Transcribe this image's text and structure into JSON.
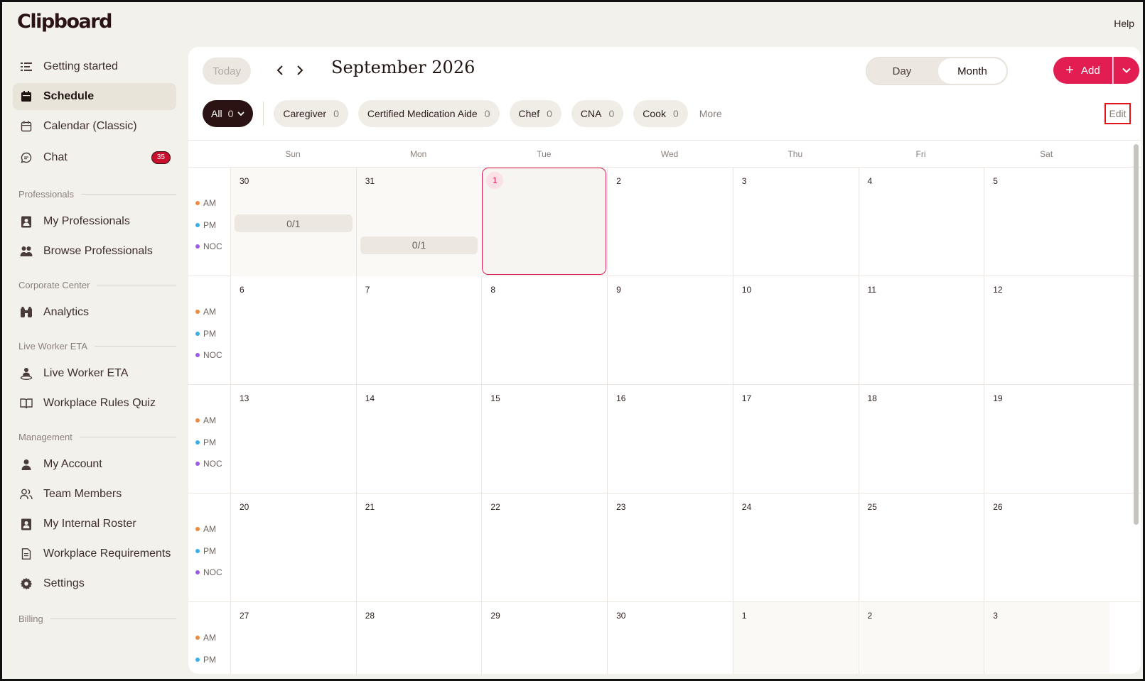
{
  "app": {
    "logo": "Clipboard",
    "help": "Help"
  },
  "sidebar": {
    "top_items": [
      {
        "label": "Getting started",
        "icon": "list-icon"
      },
      {
        "label": "Schedule",
        "icon": "calendar-filled-icon",
        "active": true
      },
      {
        "label": "Calendar (Classic)",
        "icon": "calendar-icon"
      },
      {
        "label": "Chat",
        "icon": "chat-icon",
        "badge": "35"
      }
    ],
    "sections": [
      {
        "title": "Professionals",
        "items": [
          {
            "label": "My Professionals"
          },
          {
            "label": "Browse Professionals"
          }
        ]
      },
      {
        "title": "Corporate Center",
        "items": [
          {
            "label": "Analytics"
          }
        ]
      },
      {
        "title": "Live Worker ETA",
        "items": [
          {
            "label": "Live Worker ETA"
          },
          {
            "label": "Workplace Rules Quiz"
          }
        ]
      },
      {
        "title": "Management",
        "items": [
          {
            "label": "My Account"
          },
          {
            "label": "Team Members"
          },
          {
            "label": "My Internal Roster"
          },
          {
            "label": "Workplace Requirements"
          },
          {
            "label": "Settings"
          }
        ]
      },
      {
        "title": "Billing"
      }
    ]
  },
  "toolbar": {
    "today": "Today",
    "month_title": "September 2026",
    "view_day": "Day",
    "view_month": "Month",
    "add": "Add",
    "add_plus": "+"
  },
  "filters": {
    "all": {
      "label": "All",
      "count": "0"
    },
    "chips": [
      {
        "label": "Caregiver",
        "count": "0"
      },
      {
        "label": "Certified Medication Aide",
        "count": "0"
      },
      {
        "label": "Chef",
        "count": "0"
      },
      {
        "label": "CNA",
        "count": "0"
      },
      {
        "label": "Cook",
        "count": "0"
      }
    ],
    "more": "More",
    "edit": "Edit"
  },
  "calendar": {
    "weekdays": [
      "Sun",
      "Mon",
      "Tue",
      "Wed",
      "Thu",
      "Fri",
      "Sat"
    ],
    "shifts": [
      {
        "label": "AM",
        "color": "#f08a3c"
      },
      {
        "label": "PM",
        "color": "#3ab0e8"
      },
      {
        "label": "NOC",
        "color": "#9b5de5"
      }
    ],
    "weeks": [
      [
        "30",
        "31",
        "1",
        "2",
        "3",
        "4",
        "5"
      ],
      [
        "6",
        "7",
        "8",
        "9",
        "10",
        "11",
        "12"
      ],
      [
        "13",
        "14",
        "15",
        "16",
        "17",
        "18",
        "19"
      ],
      [
        "20",
        "21",
        "22",
        "23",
        "24",
        "25",
        "26"
      ],
      [
        "27",
        "28",
        "29",
        "30",
        "1",
        "2",
        "3"
      ]
    ],
    "slots": [
      {
        "week": 0,
        "day": 0,
        "shift": "PM",
        "text": "0/1"
      },
      {
        "week": 0,
        "day": 1,
        "shift": "NOC",
        "text": "0/1"
      }
    ]
  }
}
